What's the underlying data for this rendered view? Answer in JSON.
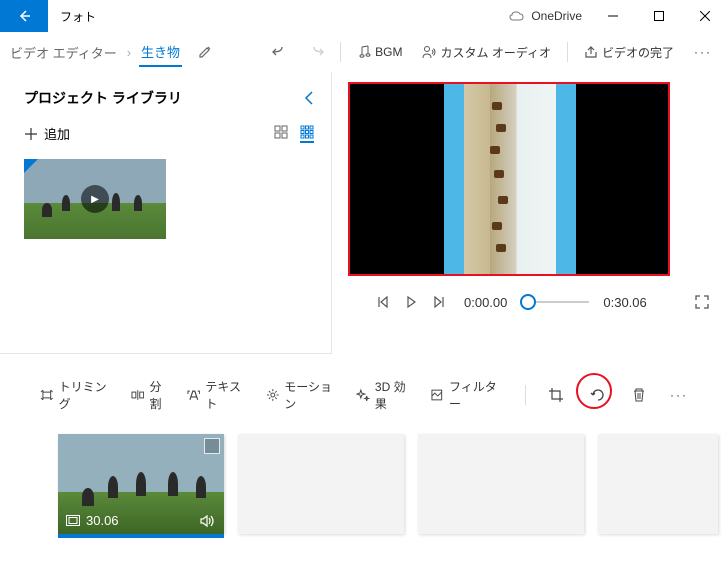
{
  "app_title": "フォト",
  "onedrive_label": "OneDrive",
  "breadcrumb": {
    "editor": "ビデオ エディター",
    "project": "生き物"
  },
  "cmd": {
    "bgm": "BGM",
    "custom_audio": "カスタム オーディオ",
    "finish": "ビデオの完了"
  },
  "library": {
    "title": "プロジェクト ライブラリ",
    "add": "追加"
  },
  "playback": {
    "current": "0:00.00",
    "duration": "0:30.06"
  },
  "toolbar": {
    "trim": "トリミング",
    "split": "分割",
    "text": "テキスト",
    "motion": "モーション",
    "fx3d": "3D 効果",
    "filter": "フィルター"
  },
  "storyboard": {
    "clip_duration": "30.06"
  }
}
